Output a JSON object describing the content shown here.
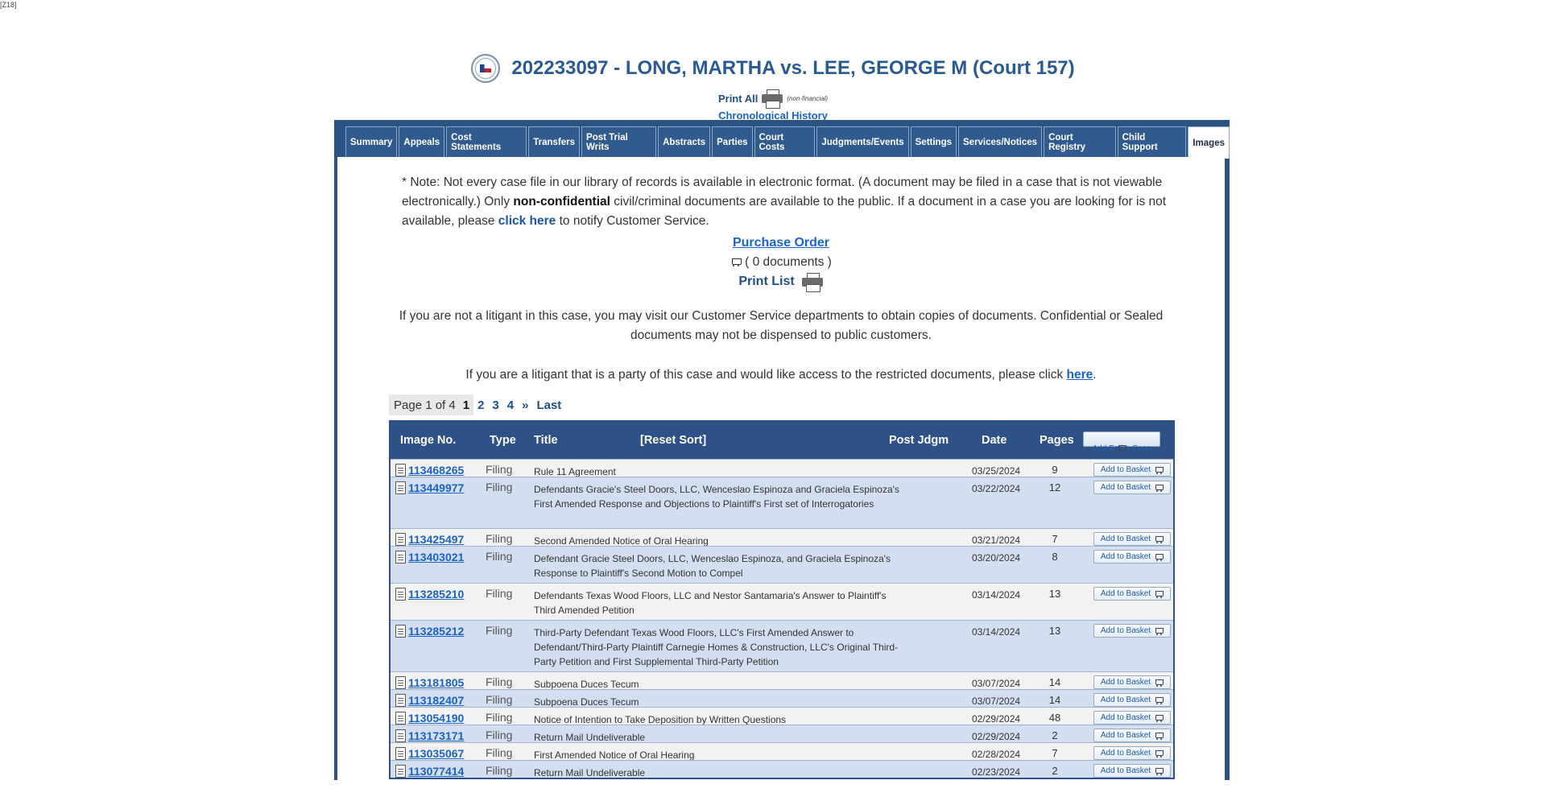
{
  "corner_tag": "[Z18]",
  "header": {
    "case_title": "202233097 - LONG, MARTHA vs. LEE, GEORGE M (Court 157)",
    "print_all": "Print All",
    "non_financial": "(non-financial)",
    "chronological_history": "Chronological History"
  },
  "tabs": [
    "Summary",
    "Appeals",
    "Cost Statements",
    "Transfers",
    "Post Trial Writs",
    "Abstracts",
    "Parties",
    "Court Costs",
    "Judgments/Events",
    "Settings",
    "Services/Notices",
    "Court Registry",
    "Child Support",
    "Images"
  ],
  "active_tab": "Images",
  "notice": {
    "p1": "* Note: Not every case file in our library of records is available in electronic format. (A document may be filed in a case that is not viewable electronically.) Only ",
    "bold": "non-confidential",
    "p2": " civil/criminal documents are available to the public. If a document in a case you are looking for is not available, please ",
    "click_here": "click here",
    "p3": " to notify Customer Service."
  },
  "purchase_order": "Purchase Order",
  "documents_count": "( 0 documents )",
  "print_list": "Print List",
  "info_not_litigant": "If you are not a litigant in this case, you may visit our Customer Service departments to obtain copies of documents. Confidential or Sealed documents may not be dispensed to public customers.",
  "info_litigant_pre": "If you are a litigant that is a party of this case and would like access to the restricted documents, please click ",
  "info_litigant_link": "here",
  "info_litigant_post": ".",
  "pager": {
    "label": "Page 1 of 4",
    "pages": [
      "1",
      "2",
      "3",
      "4"
    ],
    "next": "»",
    "last": "Last"
  },
  "table": {
    "headers": {
      "image_no": "Image No.",
      "type": "Type",
      "title": "Title",
      "reset_sort": "[Reset Sort]",
      "post_jdgm": "Post Jdgm",
      "date": "Date",
      "pages": "Pages",
      "add_entire_case": "Add Entire Case"
    },
    "add_to_basket": "Add to Basket",
    "rows": [
      {
        "image": "113468265",
        "type": "Filing",
        "title": "Rule 11 Agreement",
        "date": "03/25/2024",
        "pages": "9"
      },
      {
        "image": "113449977",
        "type": "Filing",
        "title": "Defendants Gracie's Steel Doors, LLC, Wenceslao Espinoza and Graciela Espinoza's First Amended Response and Objections to Plaintiff's First set of Interrogatories",
        "date": "03/22/2024",
        "pages": "12"
      },
      {
        "image": "113425497",
        "type": "Filing",
        "title": "Second Amended Notice of Oral Hearing",
        "date": "03/21/2024",
        "pages": "7"
      },
      {
        "image": "113403021",
        "type": "Filing",
        "title": "Defendant Gracie Steel Doors, LLC, Wenceslao Espinoza, and Graciela Espinoza's Response to Plaintiff's Second Motion to Compel",
        "date": "03/20/2024",
        "pages": "8"
      },
      {
        "image": "113285210",
        "type": "Filing",
        "title": "Defendants Texas Wood Floors, LLC and Nestor Santamaria's Answer to Plaintiff's Third Amended Petition",
        "date": "03/14/2024",
        "pages": "13"
      },
      {
        "image": "113285212",
        "type": "Filing",
        "title": "Third-Party Defendant Texas Wood Floors, LLC's First Amended Answer to Defendant/Third-Party Plaintiff Carnegie Homes & Construction, LLC's Original Third-Party Petition and First Supplemental Third-Party Petition",
        "date": "03/14/2024",
        "pages": "13"
      },
      {
        "image": "113181805",
        "type": "Filing",
        "title": "Subpoena Duces Tecum",
        "date": "03/07/2024",
        "pages": "14"
      },
      {
        "image": "113182407",
        "type": "Filing",
        "title": "Subpoena Duces Tecum",
        "date": "03/07/2024",
        "pages": "14"
      },
      {
        "image": "113054190",
        "type": "Filing",
        "title": "Notice of Intention to Take Deposition by Written Questions",
        "date": "02/29/2024",
        "pages": "48"
      },
      {
        "image": "113173171",
        "type": "Filing",
        "title": "Return Mail Undeliverable",
        "date": "02/29/2024",
        "pages": "2"
      },
      {
        "image": "113035067",
        "type": "Filing",
        "title": "First Amended Notice of Oral Hearing",
        "date": "02/28/2024",
        "pages": "7"
      },
      {
        "image": "113077414",
        "type": "Filing",
        "title": "Return Mail Undeliverable",
        "date": "02/23/2024",
        "pages": "2"
      }
    ]
  }
}
